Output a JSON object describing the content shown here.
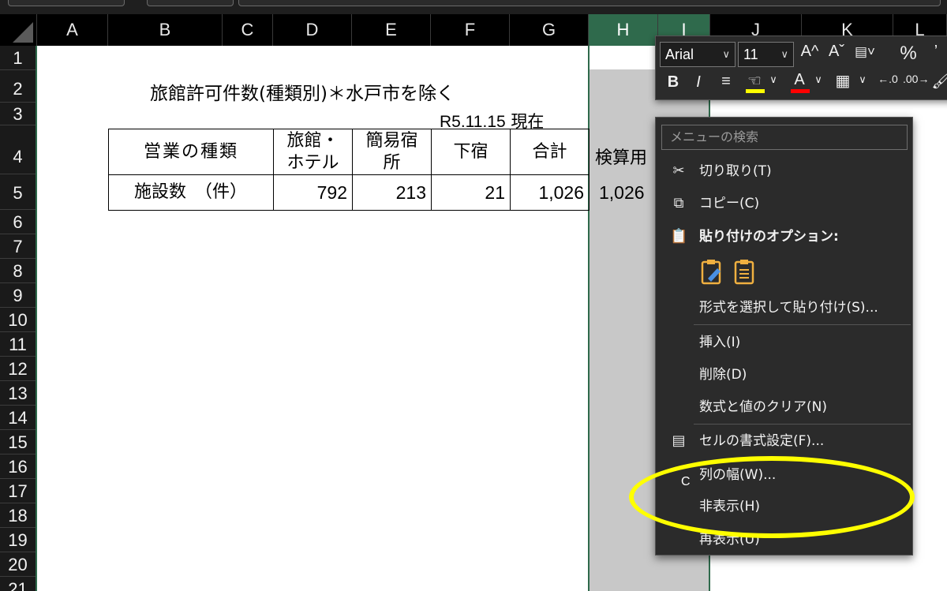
{
  "columns": [
    "A",
    "B",
    "C",
    "D",
    "E",
    "F",
    "G",
    "H",
    "I",
    "J",
    "K",
    "L"
  ],
  "rows": [
    "1",
    "2",
    "3",
    "4",
    "5",
    "6",
    "7",
    "8",
    "9",
    "10",
    "11",
    "12",
    "13",
    "14",
    "15",
    "16",
    "17",
    "18",
    "19",
    "20",
    "21"
  ],
  "sheet": {
    "title": "旅館許可件数(種類別)＊水戸市を除く",
    "as_of_date": "R5.11.15",
    "as_of_suffix": "現在",
    "table": {
      "headers": [
        "営業の種類",
        "旅館・\nホテル",
        "簡易宿\n所",
        "下宿",
        "合計"
      ],
      "row_label": "施設数　（件）",
      "values": [
        "792",
        "213",
        "21",
        "1,026"
      ]
    },
    "check_label": "検算用",
    "check_value": "1,026"
  },
  "mini_toolbar": {
    "font_name": "Arial",
    "font_size": "11",
    "increase_font": "A^",
    "decrease_font": "Aˇ",
    "percent": "%",
    "bold": "B",
    "italic": "I",
    "highlight_color": "#ffff00",
    "font_color": "#ff0000"
  },
  "context_menu": {
    "search_placeholder": "メニューの検索",
    "cut": "切り取り(T)",
    "copy": "コピー(C)",
    "paste_options": "貼り付けのオプション:",
    "paste_special": "形式を選択して貼り付け(S)...",
    "insert": "挿入(I)",
    "delete": "削除(D)",
    "clear": "数式と値のクリア(N)",
    "format_cells": "セルの書式設定(F)...",
    "column_width": "列の幅(W)...",
    "hide": "非表示(H)",
    "unhide": "再表示(U)"
  },
  "annotation": {
    "highlight_color": "#ffff00",
    "letter": "C"
  }
}
